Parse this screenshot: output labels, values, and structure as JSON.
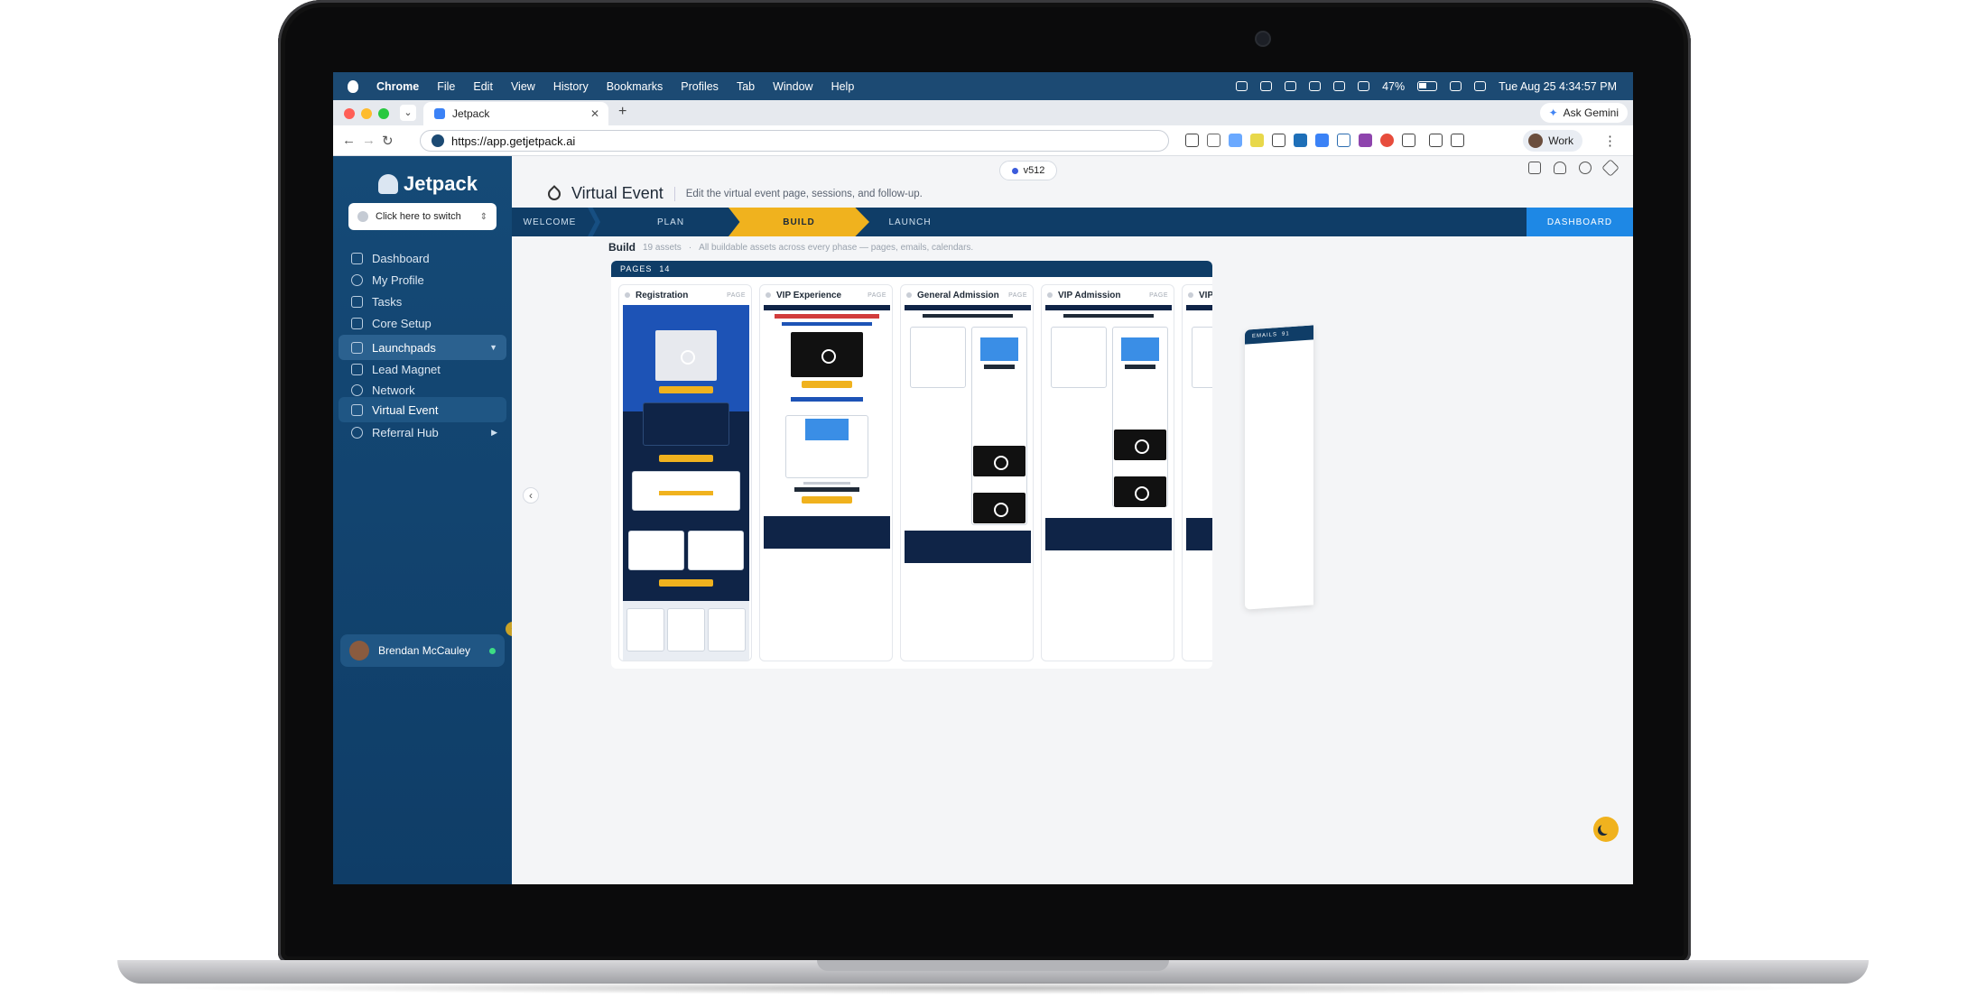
{
  "menubar": {
    "app": "Chrome",
    "items": [
      "File",
      "Edit",
      "View",
      "History",
      "Bookmarks",
      "Profiles",
      "Tab",
      "Window",
      "Help"
    ],
    "battery": "47%",
    "clock": "Tue Aug 25  4:34:57 PM"
  },
  "chrome": {
    "tab_title": "Jetpack",
    "gemini": "Ask Gemini",
    "url": "https://app.getjetpack.ai",
    "profile": "Work"
  },
  "sidebar": {
    "brand": "Jetpack",
    "switcher": "Click here to switch",
    "items": [
      {
        "label": "Dashboard"
      },
      {
        "label": "My Profile"
      },
      {
        "label": "Tasks"
      },
      {
        "label": "Core Setup"
      },
      {
        "label": "Launchpads"
      },
      {
        "label": "Lead Magnet"
      },
      {
        "label": "Network"
      },
      {
        "label": "Virtual Event"
      },
      {
        "label": "Referral Hub"
      }
    ],
    "user": "Brendan McCauley"
  },
  "main": {
    "version": "v512",
    "title": "Virtual Event",
    "subtitle": "Edit the virtual event page, sessions, and follow-up.",
    "steps": [
      "WELCOME",
      "PLAN",
      "BUILD",
      "LAUNCH"
    ],
    "dashboard": "DASHBOARD",
    "build": {
      "title": "Build",
      "count": "19 assets",
      "desc": "All buildable assets across every phase — pages, emails, calendars."
    },
    "pages": {
      "label": "PAGES",
      "count": "14",
      "type_tag": "PAGE",
      "cards": [
        {
          "title": "Registration"
        },
        {
          "title": "VIP Experience"
        },
        {
          "title": "General Admission"
        },
        {
          "title": "VIP Admission"
        },
        {
          "title": "VIP U"
        }
      ]
    },
    "emails": {
      "label": "EMAILS",
      "count": "91"
    }
  }
}
